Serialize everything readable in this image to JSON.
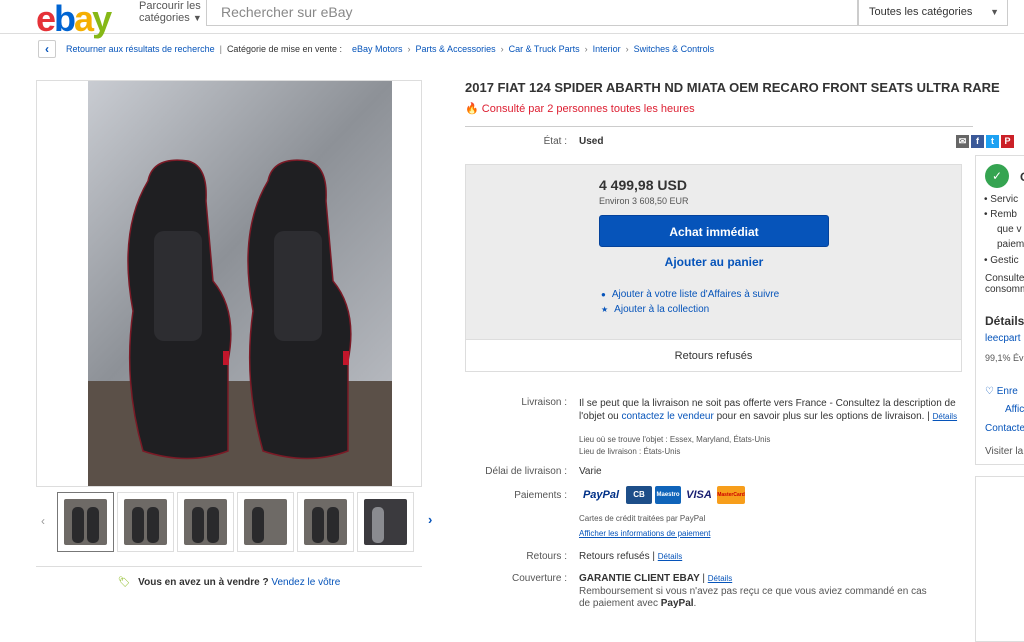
{
  "header": {
    "logo": [
      "e",
      "b",
      "a",
      "y"
    ],
    "browse_line1": "Parcourir les",
    "browse_line2": "catégories",
    "search_placeholder": "Rechercher sur eBay",
    "category_select": "Toutes les catégories"
  },
  "breadcrumb": {
    "back": "Retourner aux résultats de recherche",
    "category_label": "Catégorie de mise en vente :",
    "items": [
      "eBay Motors",
      "Parts & Accessories",
      "Car & Truck Parts",
      "Interior",
      "Switches & Controls"
    ]
  },
  "listing": {
    "title": "2017 FIAT 124 SPIDER ABARTH ND MIATA OEM RECARO FRONT SEATS ULTRA RARE",
    "watch_count": "Consulté par 2 personnes toutes les heures",
    "condition_label": "État :",
    "condition_value": "Used",
    "price": "4 499,98 USD",
    "price_eur": "Environ 3 608,50 EUR",
    "buy_now": "Achat immédiat",
    "add_to_cart": "Ajouter au panier",
    "watch_link": "Ajouter à votre liste d'Affaires à suivre",
    "collection_link": "Ajouter à la collection",
    "returns_bar": "Retours refusés"
  },
  "shipping": {
    "label": "Livraison :",
    "text_part1": "Il se peut que la livraison ne soit pas offerte vers France - Consultez la description de l'objet ou",
    "contact_link": "contactez le vendeur",
    "text_part2": "pour en savoir plus sur les options de livraison.",
    "details_link": "Détails",
    "location_line": "Lieu où se trouve l'objet : Essex, Maryland, États-Unis",
    "ships_to_line": "Lieu de livraison : États-Unis"
  },
  "delivery": {
    "label": "Délai de livraison :",
    "value": "Varie"
  },
  "payments": {
    "label": "Paiements :",
    "logos": [
      "PayPal",
      "CB",
      "Maestro",
      "VISA",
      "MasterCard"
    ],
    "credit_note": "Cartes de crédit traitées par PayPal",
    "info_link": "Afficher les informations de paiement"
  },
  "returns": {
    "label": "Retours :",
    "value": "Retours refusés",
    "details_link": "Détails"
  },
  "coverage": {
    "label": "Couverture :",
    "title": "GARANTIE CLIENT EBAY",
    "details_link": "Détails",
    "line1": "Remboursement si vous n'avez pas reçu ce que vous aviez commandé en cas",
    "line2_prefix": "de paiement avec",
    "line2_brand": "PayPal",
    "line2_suffix": "."
  },
  "sell": {
    "question": "Vous en avez un à vendre ?",
    "link": "Vendez le vôtre"
  },
  "seller_box": {
    "badge_title": "G",
    "bullets": [
      "Servic",
      "Remb",
      "que v",
      "paiem",
      "Gestic"
    ],
    "note1": "Consultez",
    "note2": "consomm",
    "details_title": "Détails",
    "seller_name": "leecpart",
    "feedback": "99,1% Év",
    "save_link_line1": "Enre",
    "save_link_line2": "Affic",
    "contact": "Contacte",
    "visit": "Visiter la"
  },
  "colors": {
    "link": "#0654ba",
    "primary_button": "#0654ba",
    "alert": "#dd1e31",
    "trust_green": "#35a451"
  }
}
